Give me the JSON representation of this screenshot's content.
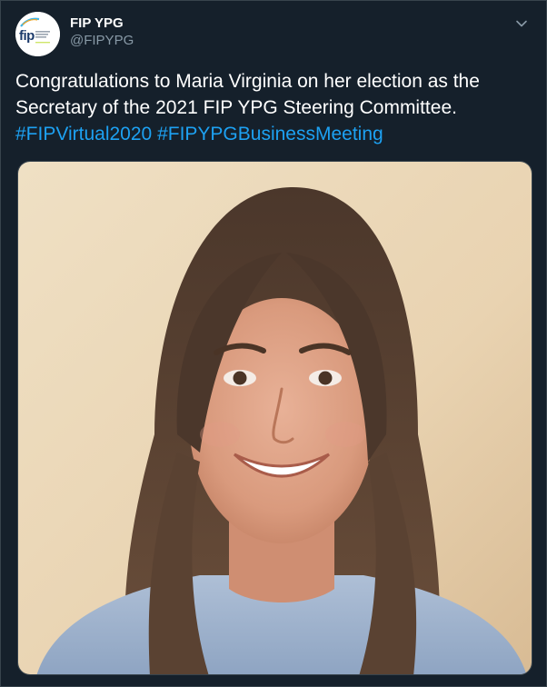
{
  "tweet": {
    "author": {
      "display_name": "FIP YPG",
      "handle": "@FIPYPG",
      "avatar_icon": "fip-logo-icon",
      "avatar_text": "fip"
    },
    "menu_icon": "chevron-down-icon",
    "text_parts": {
      "body": "Congratulations to Maria Virginia on her election as the Secretary of the 2021 FIP YPG Steering Committee. ",
      "hashtag_1": "#FIPVirtual2020",
      "separator": " ",
      "hashtag_2": "#FIPYPGBusinessMeeting"
    },
    "media": {
      "type": "photo",
      "subject": "portrait-photo"
    }
  },
  "colors": {
    "background": "#15202b",
    "text": "#ffffff",
    "secondary_text": "#8899a6",
    "link": "#1da1f2",
    "border": "#38444d"
  }
}
